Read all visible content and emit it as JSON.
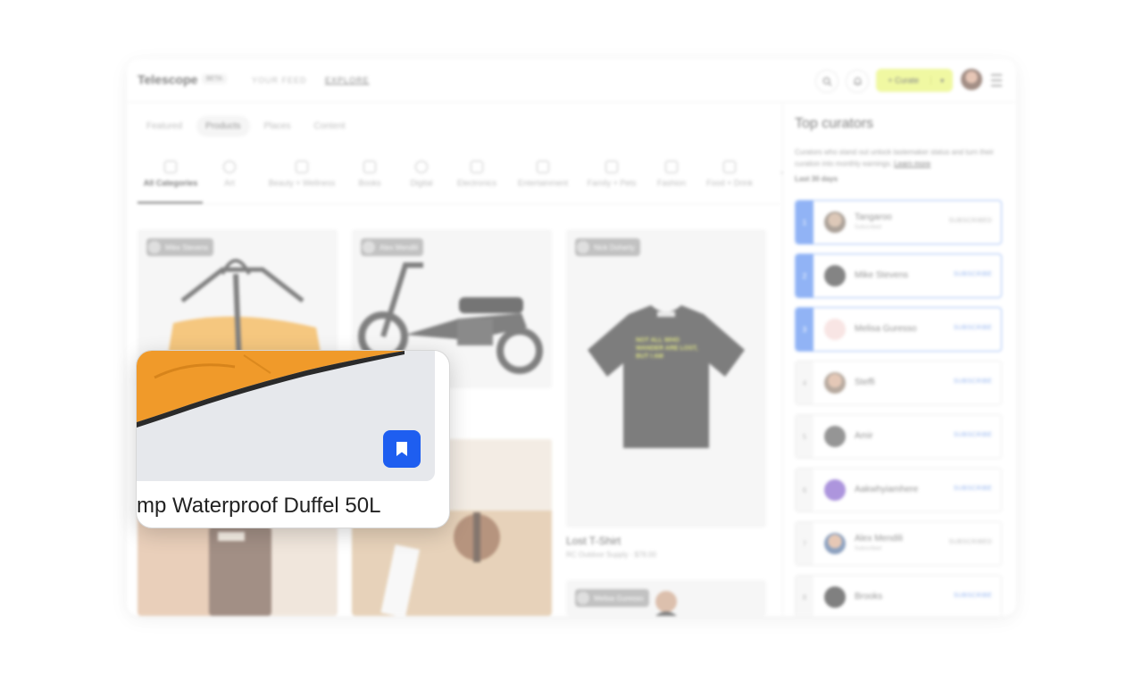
{
  "header": {
    "logo": "Telescope",
    "badge": "BETA",
    "nav": [
      "YOUR FEED",
      "EXPLORE"
    ],
    "curate_label": "+ Curate",
    "curate_dropdown": "▾"
  },
  "tabs": [
    "Featured",
    "Products",
    "Places",
    "Content"
  ],
  "active_tab": "Products",
  "categories": [
    "All Categories",
    "Art",
    "Beauty + Wellness",
    "Books",
    "Digital",
    "Electronics",
    "Entertainment",
    "Family + Pets",
    "Fashion",
    "Food + Drink"
  ],
  "cards": [
    {
      "curator": "Mike Stevens"
    },
    {
      "curator": "Alex Mendili"
    },
    {
      "curator": "Nick Doherty",
      "title": "Lost T-Shirt",
      "subtitle": "RC Outdoor Supply · $78.00",
      "shirt_text": "NOT ALL WHO WANDER ARE LOST, BUT I AM"
    },
    {
      "curator": "Melisa Guresso"
    }
  ],
  "sidebar": {
    "title": "Top curators",
    "description": "Curators who stand out unlock tastemaker status and turn their curation into monthly earnings.",
    "learn_more": "Learn more",
    "period": "Last 30 days",
    "curators": [
      {
        "rank": "1",
        "name": "Tangaroo",
        "note": "Subscribed",
        "action": "SUBSCRIBED"
      },
      {
        "rank": "2",
        "name": "Mike Stevens",
        "action": "SUBSCRIBE"
      },
      {
        "rank": "3",
        "name": "Melisa Guresso",
        "action": "SUBSCRIBE"
      },
      {
        "rank": "4",
        "name": "Steffi",
        "action": "SUBSCRIBE"
      },
      {
        "rank": "5",
        "name": "Amir",
        "action": "SUBSCRIBE"
      },
      {
        "rank": "6",
        "name": "Aakwhyiamhere",
        "action": "SUBSCRIBE"
      },
      {
        "rank": "7",
        "name": "Alex Mendili",
        "note": "Subscribed",
        "action": "SUBSCRIBED"
      },
      {
        "rank": "8",
        "name": "Brooks",
        "action": "SUBSCRIBE"
      }
    ]
  },
  "zoom": {
    "title": "mp Waterproof Duffel 50L"
  },
  "colors": {
    "accent_blue": "#1e5ef0",
    "curate_yellow": "#e8f56a",
    "rank_blue": "#4e86f0"
  }
}
